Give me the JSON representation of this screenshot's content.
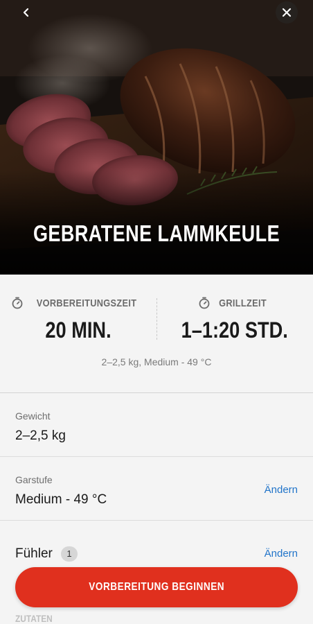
{
  "hero": {
    "title": "GEBRATENE LAMMKEULE",
    "back_icon": "chevron-left-icon",
    "close_icon": "close-icon"
  },
  "stats": {
    "prep": {
      "icon": "stopwatch-icon",
      "label": "VORBEREITUNGSZEIT",
      "value": "20 MIN."
    },
    "grill": {
      "icon": "stopwatch-icon",
      "label": "GRILLZEIT",
      "value": "1–1:20 STD."
    },
    "summary": "2–2,5 kg, Medium - 49 °C"
  },
  "settings": {
    "weight": {
      "label": "Gewicht",
      "value": "2–2,5 kg"
    },
    "doneness": {
      "label": "Garstufe",
      "value": "Medium - 49 °C",
      "action": "Ändern"
    },
    "probe": {
      "label": "Fühler",
      "count": "1",
      "action": "Ändern"
    }
  },
  "cta": {
    "label": "VORBEREITUNG BEGINNEN"
  },
  "peek": {
    "label": "ZUTATEN"
  },
  "colors": {
    "accent": "#e0301e",
    "link": "#2174c9",
    "background": "#f4f4f4"
  }
}
